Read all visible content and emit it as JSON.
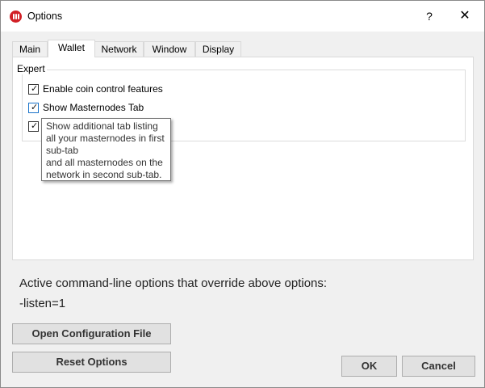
{
  "window": {
    "title": "Options",
    "help": "?",
    "close": "✕"
  },
  "tabs": [
    {
      "label": "Main"
    },
    {
      "label": "Wallet"
    },
    {
      "label": "Network"
    },
    {
      "label": "Window"
    },
    {
      "label": "Display"
    }
  ],
  "expert": {
    "title": "Expert",
    "options": [
      {
        "label": "Enable coin control features",
        "checked": true
      },
      {
        "label": "Show Masternodes Tab",
        "checked": true
      },
      {
        "label": "",
        "checked": true
      }
    ]
  },
  "tooltip": {
    "lines": [
      "Show additional tab listing",
      "all your masternodes in first",
      "sub-tab",
      "and all masternodes on the",
      "network in second sub-tab."
    ]
  },
  "overrides": {
    "title": "Active command-line options that override above options:",
    "value": "-listen=1"
  },
  "buttons": {
    "open_config": "Open Configuration File",
    "reset": "Reset Options",
    "ok": "OK",
    "cancel": "Cancel"
  },
  "colors": {
    "brand": "#d11f25",
    "focus": "#1a73c9"
  },
  "icons": {
    "app": "app-logo-icon",
    "help": "help-icon",
    "close": "close-icon",
    "check": "checkmark-icon"
  }
}
